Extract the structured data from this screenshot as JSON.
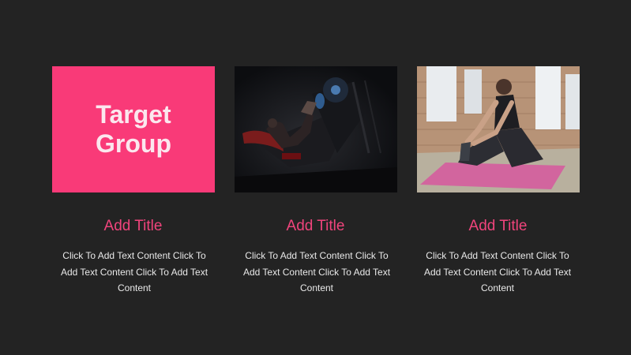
{
  "cards": [
    {
      "image_heading": "Target Group",
      "title": "Add Title",
      "text": "Click To Add Text Content Click To Add Text Content Click To Add Text Content"
    },
    {
      "image_description": "gym-leg-press-photo",
      "title": "Add Title",
      "text": "Click To Add Text Content Click To Add Text Content Click To Add Text Content"
    },
    {
      "image_description": "woman-stretching-on-yoga-mat-photo",
      "title": "Add Title",
      "text": "Click To Add Text Content Click To Add Text Content Click To Add Text Content"
    }
  ],
  "colors": {
    "background": "#232323",
    "accent": "#f93a78",
    "title": "#f0447c",
    "body_text": "#e9e9e9"
  }
}
